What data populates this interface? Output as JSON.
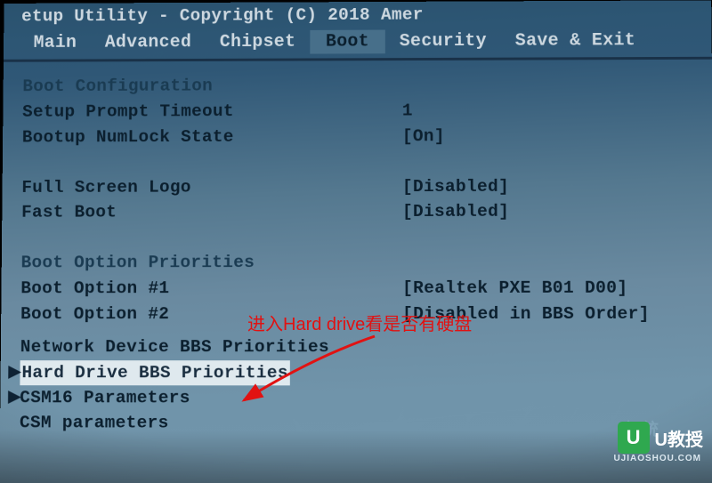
{
  "titlebar": "           etup Utility - Copyright (C) 2018 Amer",
  "menu": {
    "items": [
      "Main",
      "Advanced",
      "Chipset",
      "Boot",
      "Security",
      "Save & Exit"
    ],
    "active": "Boot"
  },
  "sections": {
    "boot_config": {
      "heading": "Boot Configuration",
      "setup_prompt_timeout": {
        "label": "Setup Prompt Timeout",
        "value": "1"
      },
      "bootup_numlock": {
        "label": "Bootup NumLock State",
        "value": "[On]"
      }
    },
    "display": {
      "full_screen_logo": {
        "label": "Full Screen Logo",
        "value": "[Disabled]"
      },
      "fast_boot": {
        "label": "Fast Boot",
        "value": "[Disabled]"
      }
    },
    "priorities": {
      "heading": "Boot Option Priorities",
      "opt1": {
        "label": "Boot Option #1",
        "value": "[Realtek PXE B01 D00]"
      },
      "opt2": {
        "label": "Boot Option #2",
        "value": "[Disabled in BBS Order]"
      }
    },
    "submenus": {
      "network": "Network Device BBS Priorities",
      "harddrive": "Hard Drive BBS Priorities",
      "csm16": "CSM16 Parameters",
      "csm": "CSM parameters"
    }
  },
  "annotation": {
    "text": "进入Hard drive看是否有硬盘"
  },
  "watermark": {
    "brand": "U教授",
    "badge": "U",
    "sub": "UJIAOSHOU.COM",
    "ghost": "电    统"
  }
}
